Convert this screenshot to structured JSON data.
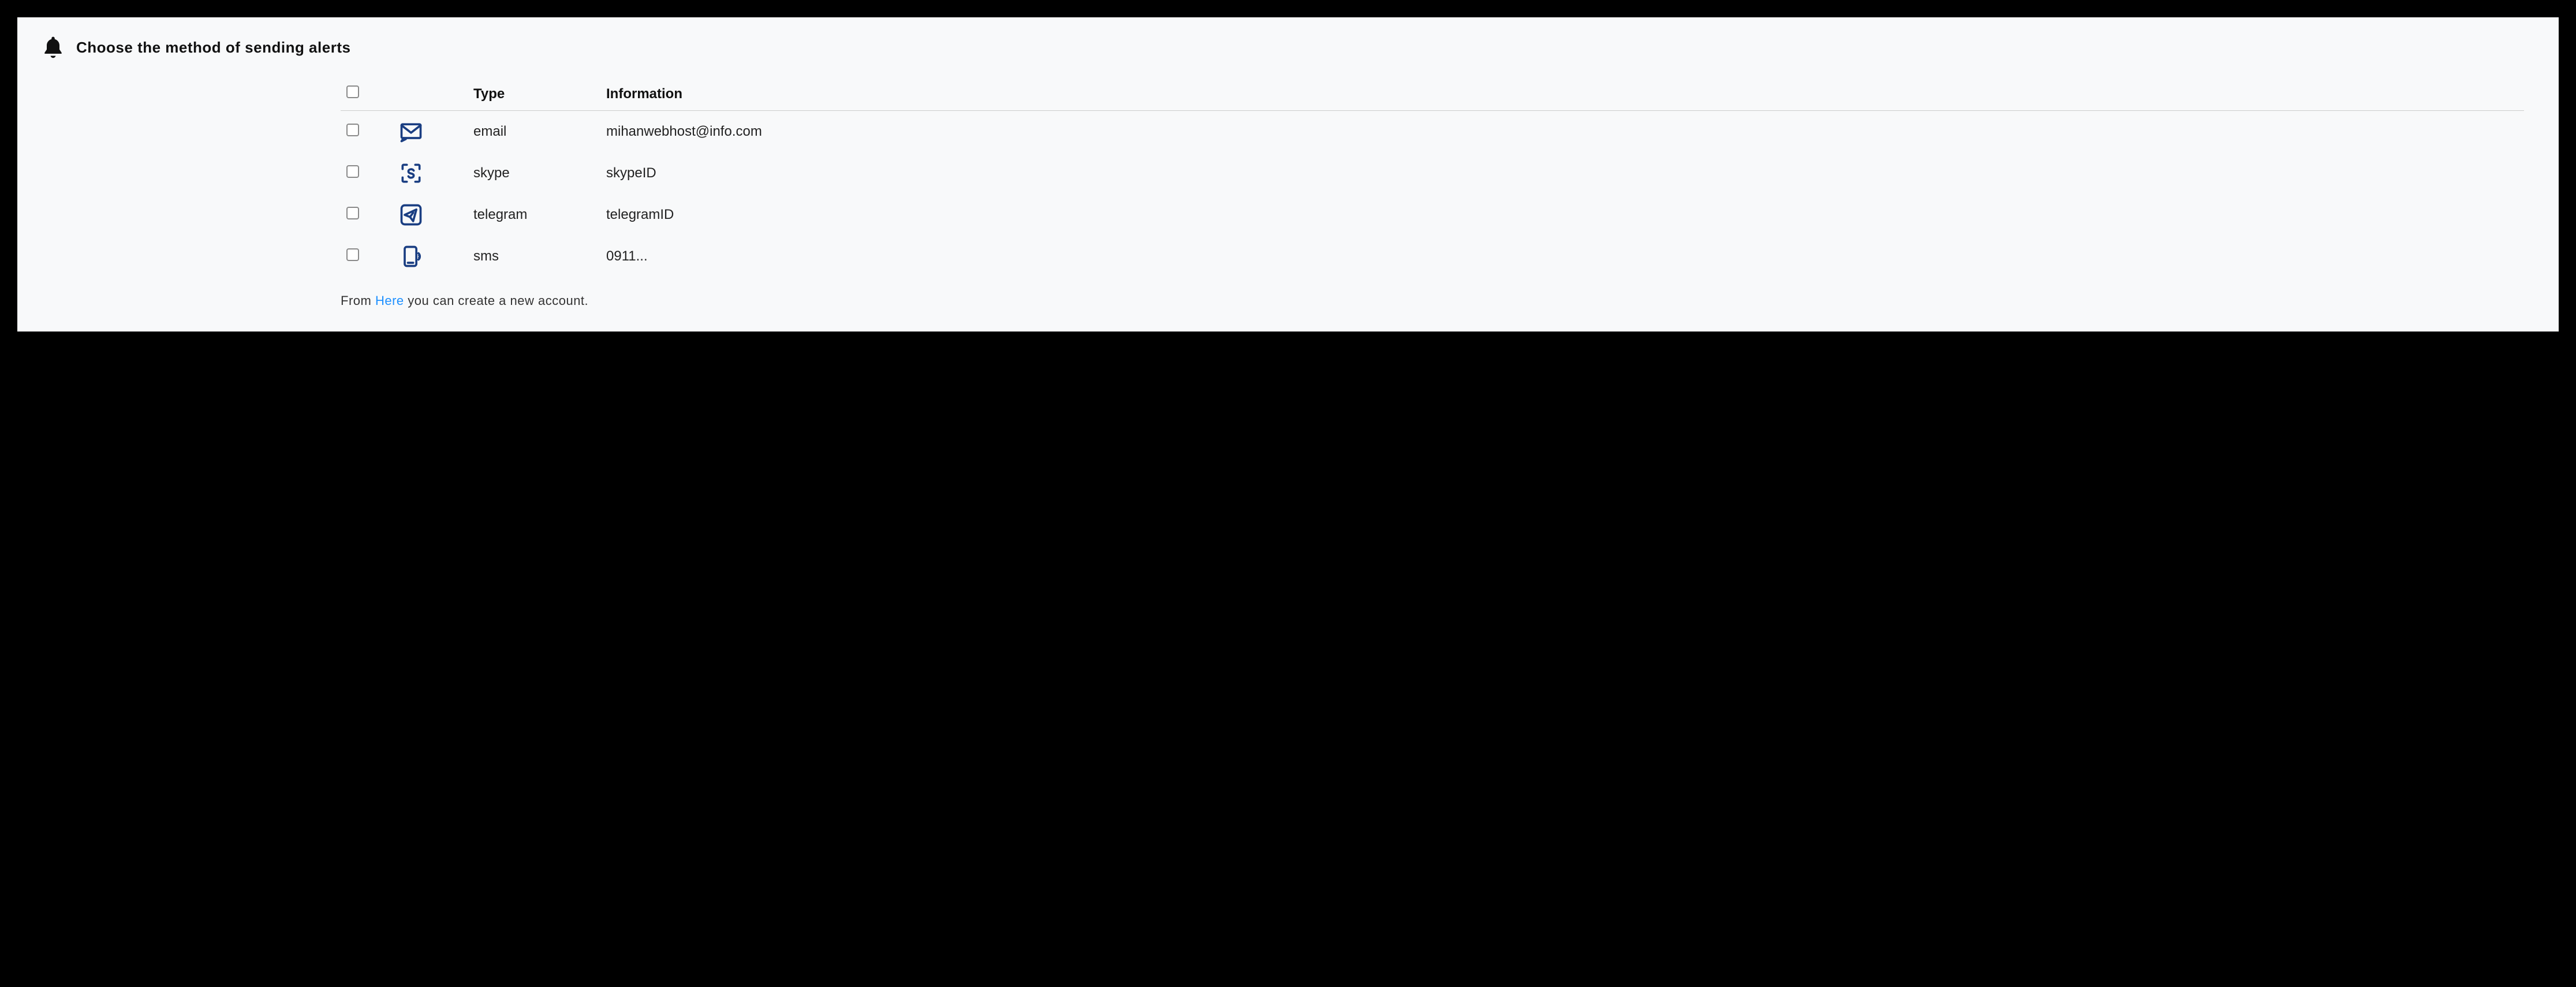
{
  "header": {
    "title": "Choose the method of sending alerts"
  },
  "table": {
    "columns": {
      "type": "Type",
      "info": "Information"
    },
    "rows": [
      {
        "icon": "email-icon",
        "type": "email",
        "info": "mihanwebhost@info.com"
      },
      {
        "icon": "skype-icon",
        "type": "skype",
        "info": "skypeID"
      },
      {
        "icon": "telegram-icon",
        "type": "telegram",
        "info": "telegramID"
      },
      {
        "icon": "sms-icon",
        "type": "sms",
        "info": "0911..."
      }
    ]
  },
  "footer": {
    "prefix": "From ",
    "link": "Here",
    "suffix": " you can create a new account."
  }
}
